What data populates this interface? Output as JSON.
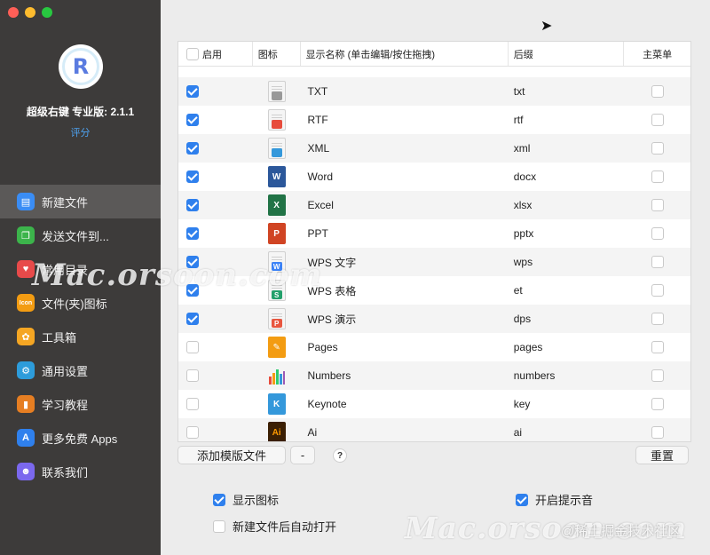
{
  "sidebar": {
    "app_name": "超级右键 专业版: 2.1.1",
    "rate_link": "评分",
    "items": [
      {
        "label": "新建文件",
        "icon": "new-file-icon",
        "color": "#3a8df5",
        "glyph": "▤",
        "active": true
      },
      {
        "label": "发送文件到...",
        "icon": "send-file-icon",
        "color": "#3cb44b",
        "glyph": "❐",
        "active": false
      },
      {
        "label": "常用目录",
        "icon": "heart-icon",
        "color": "#e84a4a",
        "glyph": "♥",
        "active": false
      },
      {
        "label": "文件(夹)图标",
        "icon": "folder-icon-label",
        "color": "#f39c12",
        "glyph": "Icon",
        "active": false
      },
      {
        "label": "工具箱",
        "icon": "toolbox-icon",
        "color": "#f5a623",
        "glyph": "✿",
        "active": false
      },
      {
        "label": "通用设置",
        "icon": "gear-icon",
        "color": "#2d9cdb",
        "glyph": "⚙",
        "active": false
      },
      {
        "label": "学习教程",
        "icon": "tutorial-icon",
        "color": "#e67e22",
        "glyph": "▮",
        "active": false
      },
      {
        "label": "更多免费 Apps",
        "icon": "app-store-icon",
        "color": "#2f80ed",
        "glyph": "A",
        "active": false
      },
      {
        "label": "联系我们",
        "icon": "contact-icon",
        "color": "#7b68ee",
        "glyph": "☻",
        "active": false
      }
    ]
  },
  "table": {
    "headers": {
      "enable": "启用",
      "icon": "图标",
      "name": "显示名称 (单击编辑/按住拖拽)",
      "suffix": "后缀",
      "main_menu": "主菜单"
    },
    "rows": [
      {
        "enabled": true,
        "icon": "txt-file-icon",
        "icon_style": "paper",
        "icon_color": "#999999",
        "icon_tag": "",
        "name": "TXT",
        "suffix": "txt",
        "main_menu": false
      },
      {
        "enabled": true,
        "icon": "rtf-file-icon",
        "icon_style": "paper",
        "icon_color": "#e74c3c",
        "icon_tag": "",
        "name": "RTF",
        "suffix": "rtf",
        "main_menu": false
      },
      {
        "enabled": true,
        "icon": "xml-file-icon",
        "icon_style": "paper",
        "icon_color": "#3498db",
        "icon_tag": "",
        "name": "XML",
        "suffix": "xml",
        "main_menu": false
      },
      {
        "enabled": true,
        "icon": "word-icon",
        "icon_style": "solid",
        "icon_color": "#2b579a",
        "icon_tag": "W",
        "name": "Word",
        "suffix": "docx",
        "main_menu": false
      },
      {
        "enabled": true,
        "icon": "excel-icon",
        "icon_style": "solid",
        "icon_color": "#217346",
        "icon_tag": "X",
        "name": "Excel",
        "suffix": "xlsx",
        "main_menu": false
      },
      {
        "enabled": true,
        "icon": "powerpoint-icon",
        "icon_style": "solid",
        "icon_color": "#d04423",
        "icon_tag": "P",
        "name": "PPT",
        "suffix": "pptx",
        "main_menu": false
      },
      {
        "enabled": true,
        "icon": "wps-writer-icon",
        "icon_style": "paper",
        "icon_color": "#3b82f6",
        "icon_tag": "W",
        "name": "WPS 文字",
        "suffix": "wps",
        "main_menu": false
      },
      {
        "enabled": true,
        "icon": "wps-sheet-icon",
        "icon_style": "paper",
        "icon_color": "#22a06b",
        "icon_tag": "S",
        "name": "WPS 表格",
        "suffix": "et",
        "main_menu": false
      },
      {
        "enabled": true,
        "icon": "wps-slides-icon",
        "icon_style": "paper",
        "icon_color": "#e8563f",
        "icon_tag": "P",
        "name": "WPS 演示",
        "suffix": "dps",
        "main_menu": false
      },
      {
        "enabled": false,
        "icon": "pages-icon",
        "icon_style": "solid",
        "icon_color": "#f39c12",
        "icon_tag": "✎",
        "name": "Pages",
        "suffix": "pages",
        "main_menu": false
      },
      {
        "enabled": false,
        "icon": "numbers-icon",
        "icon_style": "bars",
        "icon_color": "#2ecc71",
        "icon_tag": "",
        "name": "Numbers",
        "suffix": "numbers",
        "main_menu": false
      },
      {
        "enabled": false,
        "icon": "keynote-icon",
        "icon_style": "solid",
        "icon_color": "#3498db",
        "icon_tag": "K",
        "name": "Keynote",
        "suffix": "key",
        "main_menu": false
      },
      {
        "enabled": false,
        "icon": "illustrator-icon",
        "icon_style": "solid",
        "icon_color": "#3b1f04",
        "icon_tag": "Ai",
        "name": "Ai",
        "suffix": "ai",
        "main_menu": false
      }
    ]
  },
  "bottom": {
    "add_template": "添加模版文件",
    "remove": "-",
    "help": "?",
    "reset": "重置",
    "show_icon": {
      "label": "显示图标",
      "checked": true
    },
    "auto_open": {
      "label": "新建文件后自动打开",
      "checked": false
    },
    "sound": {
      "label": "开启提示音",
      "checked": true
    }
  },
  "watermark": {
    "text": "Mac.orsoon.com",
    "note": "@稀土掘金技术社区"
  },
  "colors": {
    "accent": "#2f80ed",
    "sidebar_bg": "#3d3b3a",
    "sidebar_active": "#5b5958"
  }
}
